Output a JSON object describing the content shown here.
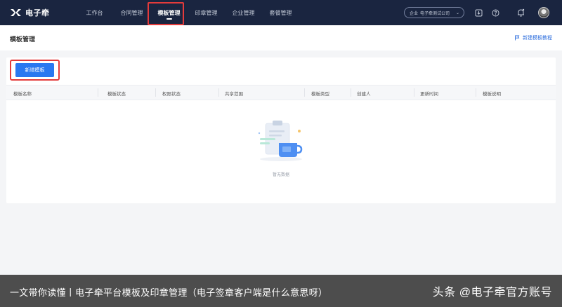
{
  "brand": {
    "name": "电子牵"
  },
  "nav": [
    {
      "label": "工作台",
      "active": false
    },
    {
      "label": "合同管理",
      "active": false
    },
    {
      "label": "模板管理",
      "active": true
    },
    {
      "label": "印章管理",
      "active": false
    },
    {
      "label": "企业管理",
      "active": false
    },
    {
      "label": "套餐管理",
      "active": false
    }
  ],
  "company": {
    "prefix": "企业",
    "name": "电子牵测试公司"
  },
  "header": {
    "title": "模板管理",
    "tutorial_label": "新建模板教程"
  },
  "toolbar": {
    "add_label": "新增模板"
  },
  "table": {
    "columns": [
      "模板名称",
      "模板状态",
      "权限状态",
      "共享范围",
      "模板类型",
      "创建人",
      "更新时间",
      "模板说明"
    ],
    "rows": []
  },
  "empty": {
    "text": "暂无数据"
  },
  "caption": {
    "left": "一文带你读懂丨电子牵平台模板及印章管理（电子签章客户端是什么意思呀）",
    "right": "头条 @电子牵官方账号"
  },
  "colors": {
    "topbar": "#1a2540",
    "accent": "#2a78f0",
    "highlight": "#e43b3b"
  }
}
